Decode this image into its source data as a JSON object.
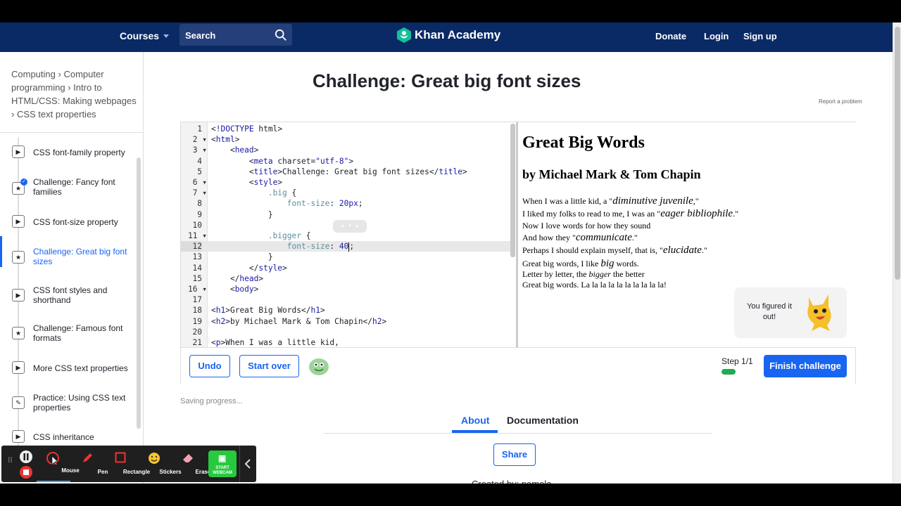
{
  "nav": {
    "courses": "Courses",
    "search_placeholder": "Search",
    "logo": "Khan Academy",
    "donate": "Donate",
    "login": "Login",
    "signup": "Sign up"
  },
  "breadcrumb": {
    "items": [
      "Computing",
      "Computer programming",
      "Intro to HTML/CSS: Making webpages",
      "CSS text properties"
    ]
  },
  "sidebar": {
    "items": [
      {
        "label": "CSS font-family property",
        "icon": "play-icon"
      },
      {
        "label": "Challenge: Fancy font families",
        "icon": "star-icon"
      },
      {
        "label": "CSS font-size property",
        "icon": "play-icon"
      },
      {
        "label": "Challenge: Great big font sizes",
        "icon": "star-icon"
      },
      {
        "label": "CSS font styles and shorthand",
        "icon": "play-icon"
      },
      {
        "label": "Challenge: Famous font formats",
        "icon": "star-icon"
      },
      {
        "label": "More CSS text properties",
        "icon": "play-icon"
      },
      {
        "label": "Practice: Using CSS text properties",
        "icon": "pencil-icon"
      },
      {
        "label": "CSS inheritance",
        "icon": "play-icon"
      }
    ]
  },
  "main": {
    "title": "Challenge: Great big font sizes",
    "report": "Report a problem"
  },
  "code": {
    "lines": [
      "<!DOCTYPE html>",
      "<html>",
      "    <head>",
      "        <meta charset=\"utf-8\">",
      "        <title>Challenge: Great big font sizes</title>",
      "        <style>",
      "            .big {",
      "                font-size: 20px;",
      "            }",
      "",
      "            .bigger {",
      "                font-size: 40",
      "            }",
      "        </style>",
      "    </head>",
      "    <body>",
      "",
      "<h1>Great Big Words</h1>",
      "<h2>by Michael Mark & Tom Chapin</h2>",
      "",
      "<p>When I was a little kid,"
    ]
  },
  "preview": {
    "h1": "Great Big Words",
    "h2": "by Michael Mark & Tom Chapin",
    "l1a": "When I was a little kid, a \"",
    "l1b": "diminutive juvenile",
    "l1c": ",\"",
    "l2a": "I liked my folks to read to me, I was an \"",
    "l2b": "eager bibliophile",
    "l2c": ".\"",
    "l3": "Now I love words for how they sound",
    "l4a": "And how they \"",
    "l4b": "communicate",
    "l4c": ".\"",
    "l5a": "Perhaps I should explain myself, that is, \"",
    "l5b": "elucidate",
    "l5c": ".\"",
    "l6a": "Great big words, I like ",
    "l6b": "big",
    "l6c": " words.",
    "l7a": "Letter by letter, the ",
    "l7b": "bigger",
    "l7c": " the better",
    "l8": "Great big words. La la la la la la la la la la!"
  },
  "figured": {
    "text": "You figured it out!"
  },
  "controls": {
    "undo": "Undo",
    "start_over": "Start over",
    "step": "Step 1/1",
    "finish": "Finish challenge"
  },
  "status": {
    "saving": "Saving progress..."
  },
  "tabs": {
    "about": "About",
    "documentation": "Documentation"
  },
  "share": "Share",
  "created": "Created by: pamela",
  "recorder": {
    "mouse": "Mouse",
    "pen": "Pen",
    "rectangle": "Rectangle",
    "stickers": "Stickers",
    "eraser": "Eraser",
    "start_webcam": "START WEBCAM"
  },
  "colors": {
    "nav_bg": "#0a2a66",
    "accent": "#1865f2",
    "success": "#1fab54"
  }
}
